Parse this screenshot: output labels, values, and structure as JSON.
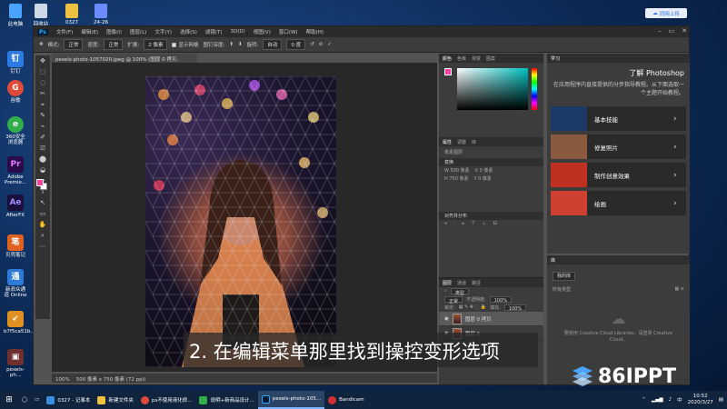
{
  "desktop": {
    "top_icons": [
      {
        "label": "此电脑",
        "color": "#4aa3ff"
      },
      {
        "label": "回收站",
        "color": "#cfd8e6"
      },
      {
        "label": "0327",
        "color": "#f0c040"
      },
      {
        "label": "24-26",
        "color": "#6a8cff"
      }
    ],
    "left_icons": [
      {
        "label": "钉钉",
        "glyph": "钉",
        "color": "#2c7be5"
      },
      {
        "label": "谷歌",
        "glyph": "G",
        "color": "#e04a3a"
      },
      {
        "label": "360安全浏览器",
        "glyph": "e",
        "color": "#2fae4a"
      },
      {
        "label": "Adobe Premie...",
        "glyph": "Pr",
        "color": "#2a0a4a"
      },
      {
        "label": "AfterFX",
        "glyph": "Ae",
        "color": "#1a0f3a"
      },
      {
        "label": "贝壳笔记",
        "glyph": "笔",
        "color": "#e06020"
      },
      {
        "label": "新浪众通道 Online",
        "glyph": "通",
        "color": "#2d7bd6"
      },
      {
        "label": "b7f5ca51b...",
        "glyph": "↙",
        "color": "#e09020"
      },
      {
        "label": "pexels-ph...",
        "glyph": "▣",
        "color": "#703030"
      }
    ],
    "cloud_button": "同网上传"
  },
  "photoshop": {
    "logo": "Ps",
    "menu": [
      "文件(F)",
      "编辑(E)",
      "图像(I)",
      "图层(L)",
      "文字(Y)",
      "选择(S)",
      "滤镜(T)",
      "3D(D)",
      "视图(V)",
      "窗口(W)",
      "帮助(H)"
    ],
    "options": {
      "mode_label": "模式:",
      "mode_value": "正常",
      "density_label": "密度:",
      "density_value": "正常",
      "expand_label": "扩展:",
      "expand_value": "2 像素",
      "show_mesh": "显示网格",
      "pin_depth_label": "图钉深度:",
      "rotate_label": "旋转:",
      "rotate_mode": "自动",
      "rotate_value": "0 度"
    },
    "tools": [
      "✥",
      "⬚",
      "◌",
      "✂",
      "⌖",
      "✎",
      "⌁",
      "✐",
      "⎚",
      "⬤",
      "◒",
      "✒",
      "T",
      "↖",
      "▭",
      "✋",
      "⌕",
      "⋯"
    ],
    "document_tab": "pexels-photo-1057020.jpeg @ 100% (图层 0 拷贝, RGB/8) *",
    "status_zoom": "100%",
    "status_size": "500 像素 x 750 像素 (72 ppi)",
    "caption": "2. 在编辑菜单那里找到操控变形选项",
    "color_tabs": [
      "颜色",
      "色板",
      "渐变",
      "图案"
    ],
    "props_tabs": [
      "属性",
      "调整",
      "库"
    ],
    "props_layer_label": "像素图层",
    "transform_label": "变换",
    "transform_fields": [
      "W 500 像素",
      "X 0 像素",
      "H 750 像素",
      "Y 0 像素"
    ],
    "align_label": "对齐并分布",
    "layers_tabs": [
      "图层",
      "通道",
      "路径"
    ],
    "layers_kind": "类型",
    "blend_mode": "正常",
    "opacity_label": "不透明度:",
    "opacity_value": "100%",
    "lock_label": "锁定:",
    "fill_label": "填充:",
    "fill_value": "100%",
    "layers": [
      {
        "name": "图层 0 拷贝",
        "active": true
      },
      {
        "name": "图层 0",
        "active": false
      }
    ],
    "learn": {
      "tab": "学习",
      "title": "了解 Photoshop",
      "desc": "在应用程序内直接提供的分步指导教程。从下面选取一个主题开始教程。",
      "cards": [
        {
          "label": "基本技能",
          "color": "#1c3a66"
        },
        {
          "label": "修复照片",
          "color": "#8a5a40"
        },
        {
          "label": "制作创意效果",
          "color": "#c03020"
        },
        {
          "label": "绘画",
          "color": "#d04030"
        }
      ]
    },
    "library": {
      "tab": "库",
      "dropdown": "我的库",
      "search": "所有类型",
      "cc_text": "要使用 Creative Cloud Libraries，请登录 Creative Cloud。"
    }
  },
  "taskbar": {
    "items": [
      {
        "label": "0327 - 记事本",
        "color": "#3b8de0"
      },
      {
        "label": "新建文件夹",
        "color": "#f0c040"
      },
      {
        "label": "ps不使用液化修...",
        "color": "#e04a3a"
      },
      {
        "label": "说明+新商品设计...",
        "color": "#2fae4a"
      },
      {
        "label": "pexels-photo-105...",
        "color": "#31a8ff"
      },
      {
        "label": "Bandicam",
        "color": "#d03030"
      }
    ],
    "active_index": 4,
    "time": "10:52",
    "date": "2020/3/27",
    "tray_lang": "中"
  },
  "watermark": "86IPPT"
}
